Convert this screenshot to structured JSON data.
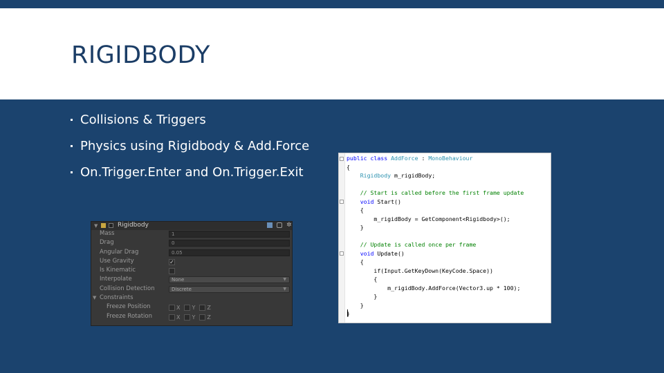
{
  "slide": {
    "title": "RIGIDBODY",
    "bullets": [
      "Collisions & Triggers",
      "Physics using Rigidbody & Add.Force",
      "On.Trigger.Enter and On.Trigger.Exit"
    ]
  },
  "inspector": {
    "component_name": "Rigidbody",
    "rows": {
      "mass": {
        "label": "Mass",
        "value": "1"
      },
      "drag": {
        "label": "Drag",
        "value": "0"
      },
      "angular_drag": {
        "label": "Angular Drag",
        "value": "0.05"
      },
      "use_gravity": {
        "label": "Use Gravity",
        "value": "✓"
      },
      "is_kinematic": {
        "label": "Is Kinematic",
        "value": ""
      },
      "interpolate": {
        "label": "Interpolate",
        "value": "None"
      },
      "collision_detection": {
        "label": "Collision Detection",
        "value": "Discrete"
      },
      "constraints": {
        "label": "Constraints"
      },
      "freeze_position": {
        "label": "Freeze Position",
        "axes": [
          "X",
          "Y",
          "Z"
        ]
      },
      "freeze_rotation": {
        "label": "Freeze Rotation",
        "axes": [
          "X",
          "Y",
          "Z"
        ]
      }
    }
  },
  "code": {
    "l1a": "public class ",
    "l1b": "AddForce",
    "l1c": " : ",
    "l1d": "MonoBehaviour",
    "l2": "{",
    "l3a": "    ",
    "l3b": "Rigidbody",
    "l3c": " m_rigidBody;",
    "l5": "    // Start is called before the first frame update",
    "l6a": "    void ",
    "l6b": "Start()",
    "l7": "    {",
    "l8": "        m_rigidBody = GetComponent<Rigidbody>();",
    "l9": "    }",
    "l11": "    // Update is called once per frame",
    "l12a": "    void ",
    "l12b": "Update()",
    "l13": "    {",
    "l14": "        if(Input.GetKeyDown(KeyCode.Space))",
    "l15": "        {",
    "l16": "            m_rigidBody.AddForce(Vector3.up * 100);",
    "l17": "        }",
    "l18": "    }",
    "l19": "}"
  }
}
